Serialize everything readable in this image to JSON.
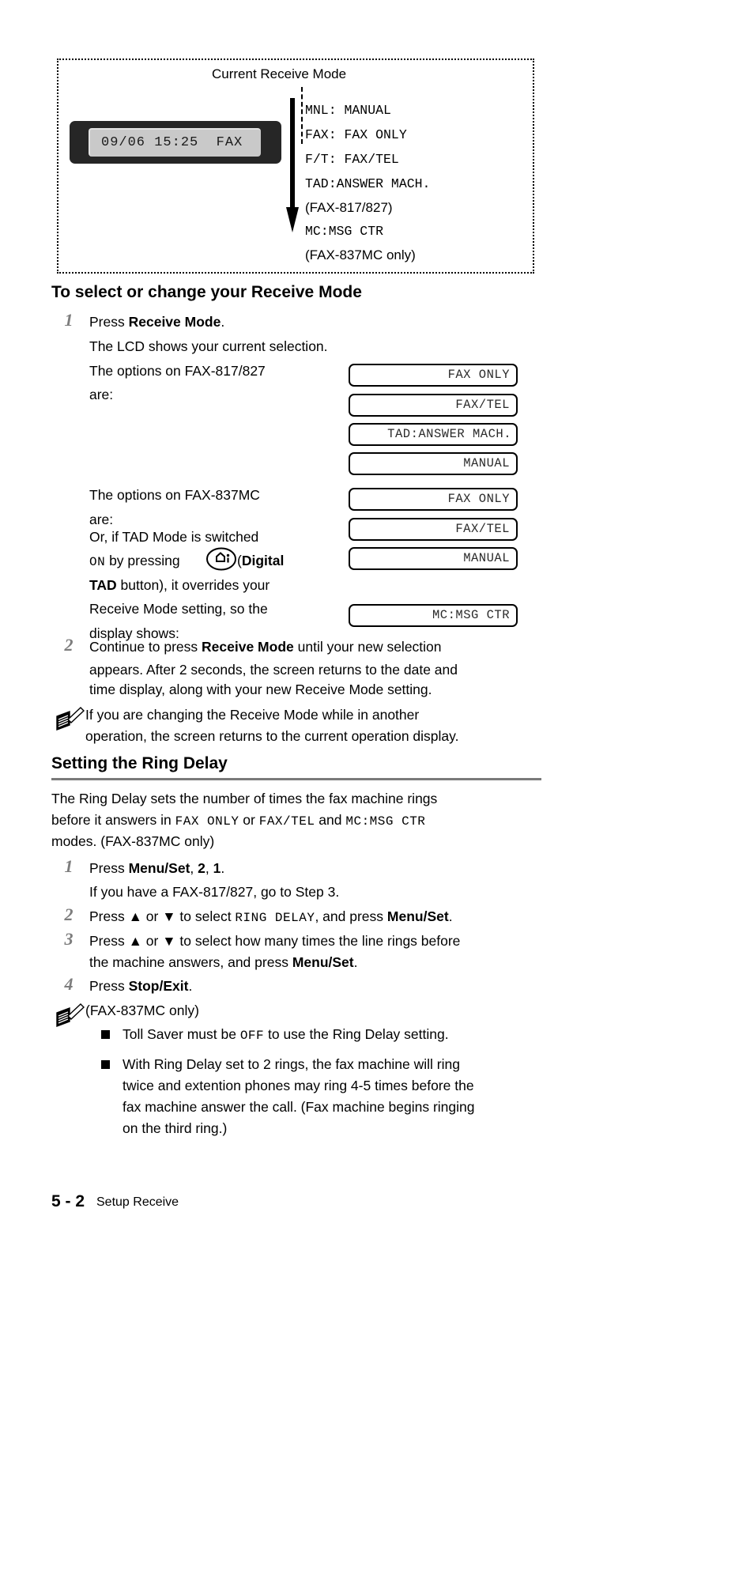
{
  "diagram": {
    "caption": "Current Receive Mode",
    "lcd_display": "09/06 15:25  FAX",
    "modes": [
      "MNL: MANUAL",
      "FAX: FAX ONLY",
      "F/T: FAX/TEL",
      "TAD:ANSWER MACH."
    ],
    "note_817": "(FAX-817/827)",
    "mode_mc": "MC:MSG CTR",
    "note_837": "(FAX-837MC only)"
  },
  "section1": {
    "heading": "To select or change your Receive Mode",
    "step1_num": "1",
    "step1_line1_pre": "Press ",
    "step1_line1_bold": "Receive Mode",
    "step1_line1_post": ".",
    "step1_line2": "The LCD shows your current selection.",
    "step1_line3a": "The options on FAX-817/827",
    "step1_line3b": "are:",
    "options_817": [
      "FAX ONLY",
      "FAX/TEL",
      "TAD:ANSWER MACH.",
      "MANUAL"
    ],
    "step1_line4a": "The options on FAX-837MC",
    "step1_line4b": "are:",
    "options_837": [
      "FAX ONLY",
      "FAX/TEL",
      "MANUAL"
    ],
    "tad_line1": "Or, if TAD Mode is switched",
    "tad_line2_on": "ON",
    "tad_line2_mid": " by pressing ",
    "tad_line2_paren": "(",
    "tad_line2_bold": "Digital",
    "tad_line3_bold": "TAD",
    "tad_line3_rest": " button), it overrides your",
    "tad_line4": "Receive Mode setting, so the",
    "tad_line5": "display shows:",
    "option_mc": "MC:MSG CTR",
    "step2_num": "2",
    "step2_pre": "Continue to press ",
    "step2_bold": "Receive Mode",
    "step2_post": " until your new selection",
    "step2_line2": "appears. After 2 seconds, the screen returns to the date and",
    "step2_line3": "time display, along with your new Receive Mode setting.",
    "note_line1": "If you are changing the Receive Mode while in another",
    "note_line2": "operation, the screen returns to the current operation display."
  },
  "section2": {
    "heading": "Setting the Ring Delay",
    "intro_line1": "The Ring Delay sets the number of times the fax machine rings",
    "intro_line2_a": "before it answers in ",
    "intro_line2_m1": "FAX ONLY",
    "intro_line2_b": " or ",
    "intro_line2_m2": "FAX/TEL",
    "intro_line2_c": " and ",
    "intro_line2_m3": "MC:MSG CTR",
    "intro_line3": "modes. (FAX-837MC only)",
    "step1_num": "1",
    "step1_pre": "Press ",
    "step1_bold1": "Menu/Set",
    "step1_mid": ", ",
    "step1_bold2": "2",
    "step1_mid2": ", ",
    "step1_bold3": "1",
    "step1_post": ".",
    "step1_sub": "If you have a FAX-817/827, go to Step 3.",
    "step2_num": "2",
    "step2_a": "Press ▲ or ▼ to select ",
    "step2_mono": "RING DELAY",
    "step2_b": ", and press ",
    "step2_bold": "Menu/Set",
    "step2_c": ".",
    "step3_num": "3",
    "step3_line1": "Press ▲ or ▼ to select how many times the line rings before",
    "step3_line2_a": "the machine answers, and press ",
    "step3_line2_bold": "Menu/Set",
    "step3_line2_b": ".",
    "step4_num": "4",
    "step4_pre": "Press ",
    "step4_bold": "Stop/Exit",
    "step4_post": ".",
    "note_header": "(FAX-837MC only)",
    "bullet1_a": "Toll Saver must be ",
    "bullet1_mono": "OFF",
    "bullet1_b": " to use the Ring Delay setting.",
    "bullet2_line1": "With Ring Delay set to 2 rings, the fax machine will ring",
    "bullet2_line2": "twice and extention phones may ring 4-5 times before the",
    "bullet2_line3": "fax machine answer the call. (Fax machine begins ringing",
    "bullet2_line4": "on the third ring.)"
  },
  "footer": {
    "page_number": "5 - 2",
    "chapter": "Setup Receive"
  }
}
